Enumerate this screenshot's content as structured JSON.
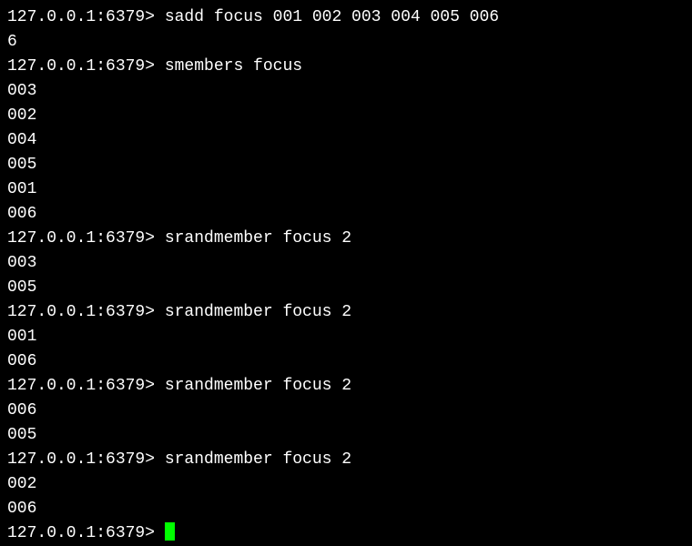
{
  "prompt": "127.0.0.1:6379> ",
  "entries": [
    {
      "type": "cmd",
      "text": "sadd focus 001 002 003 004 005 006"
    },
    {
      "type": "out",
      "text": "6"
    },
    {
      "type": "cmd",
      "text": "smembers focus"
    },
    {
      "type": "out",
      "text": "003"
    },
    {
      "type": "out",
      "text": "002"
    },
    {
      "type": "out",
      "text": "004"
    },
    {
      "type": "out",
      "text": "005"
    },
    {
      "type": "out",
      "text": "001"
    },
    {
      "type": "out",
      "text": "006"
    },
    {
      "type": "cmd",
      "text": "srandmember focus 2"
    },
    {
      "type": "out",
      "text": "003"
    },
    {
      "type": "out",
      "text": "005"
    },
    {
      "type": "cmd",
      "text": "srandmember focus 2"
    },
    {
      "type": "out",
      "text": "001"
    },
    {
      "type": "out",
      "text": "006"
    },
    {
      "type": "cmd",
      "text": "srandmember focus 2"
    },
    {
      "type": "out",
      "text": "006"
    },
    {
      "type": "out",
      "text": "005"
    },
    {
      "type": "cmd",
      "text": "srandmember focus 2"
    },
    {
      "type": "out",
      "text": "002"
    },
    {
      "type": "out",
      "text": "006"
    }
  ]
}
